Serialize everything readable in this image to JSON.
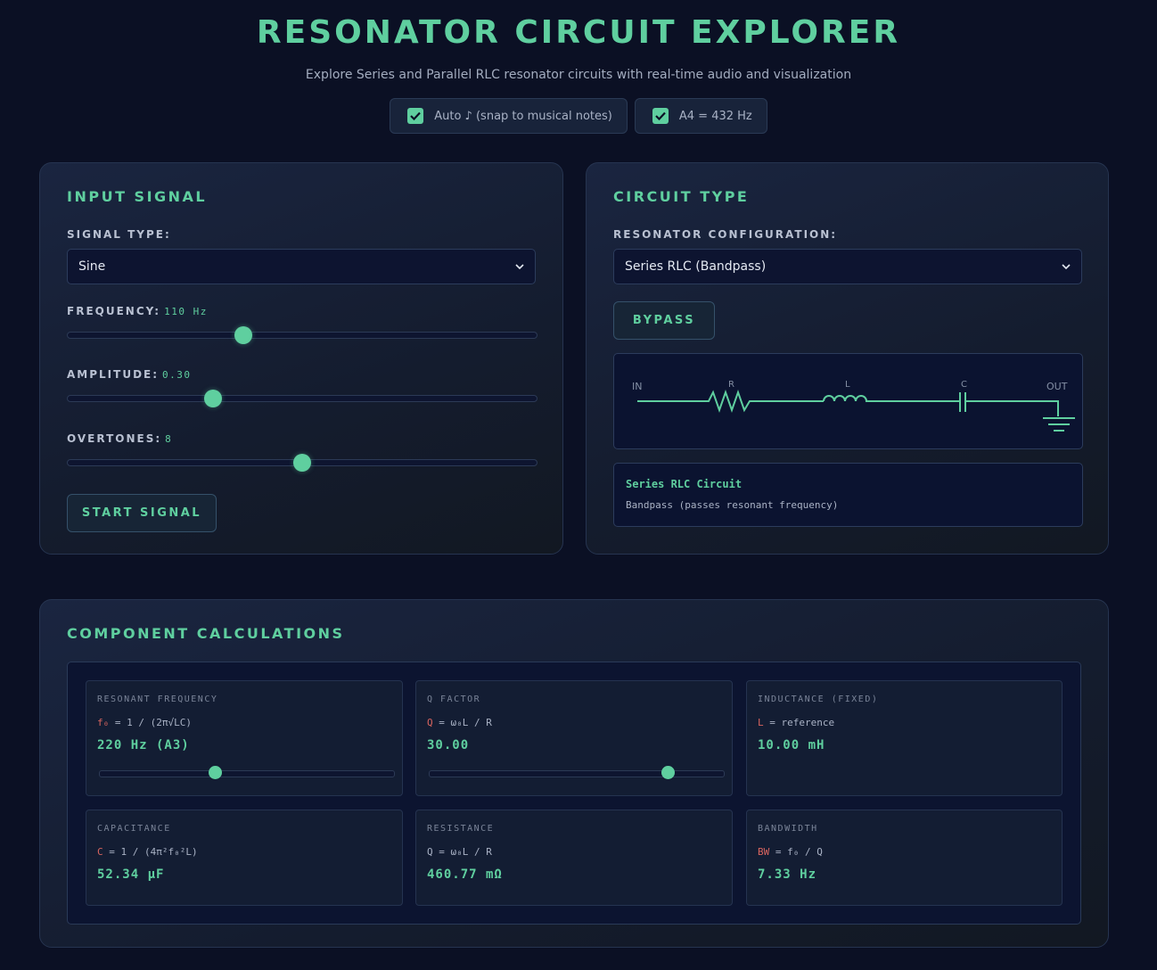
{
  "header": {
    "title": "RESONATOR CIRCUIT EXPLORER",
    "subtitle": "Explore Series and Parallel RLC resonator circuits with real-time audio and visualization",
    "toggles": [
      {
        "label": "Auto ♪ (snap to musical notes)",
        "checked": true
      },
      {
        "label": "A4 = 432 Hz",
        "checked": true
      }
    ]
  },
  "input_signal": {
    "title": "INPUT SIGNAL",
    "signal_type_label": "SIGNAL TYPE:",
    "signal_type_value": "Sine",
    "frequency_label": "FREQUENCY:",
    "frequency_value": "110 Hz",
    "frequency_level": 0.375,
    "amplitude_label": "AMPLITUDE:",
    "amplitude_value": "0.30",
    "amplitude_level": 0.31,
    "overtones_label": "OVERTONES:",
    "overtones_value": "8",
    "overtones_level": 0.5,
    "start_button": "START SIGNAL"
  },
  "circuit_type": {
    "title": "CIRCUIT TYPE",
    "config_label": "RESONATOR CONFIGURATION:",
    "config_value": "Series RLC (Bandpass)",
    "bypass_button": "BYPASS",
    "diagram": {
      "in": "IN",
      "r": "R",
      "l": "L",
      "c": "C",
      "out": "OUT"
    },
    "info_title": "Series RLC Circuit",
    "info_desc": "Bandpass (passes resonant frequency)"
  },
  "calculations": {
    "title": "COMPONENT CALCULATIONS",
    "cards": [
      {
        "title": "RESONANT FREQUENCY",
        "var": "f₀",
        "formula": " = 1 / (2π√LC)",
        "value": "220 Hz (A3)",
        "level": 0.39
      },
      {
        "title": "Q FACTOR",
        "var": "Q",
        "formula": " = ω₀L / R",
        "value": "30.00",
        "level": 0.81
      },
      {
        "title": "INDUCTANCE (FIXED)",
        "var": "L",
        "formula": " = reference",
        "value": "10.00 mH"
      },
      {
        "title": "CAPACITANCE",
        "var": "C",
        "formula": " = 1 / (4π²f₀²L)",
        "value": "52.34 µF"
      },
      {
        "title": "RESISTANCE",
        "var": "",
        "formula": "Q = ω₀L / R",
        "value": "460.77 mΩ"
      },
      {
        "title": "BANDWIDTH",
        "var": "BW",
        "formula": " = f₀ / Q",
        "value": "7.33 Hz"
      }
    ]
  },
  "colors": {
    "accent": "#5fcf9f",
    "background": "#0b1024",
    "formula_var": "#d9655f"
  }
}
